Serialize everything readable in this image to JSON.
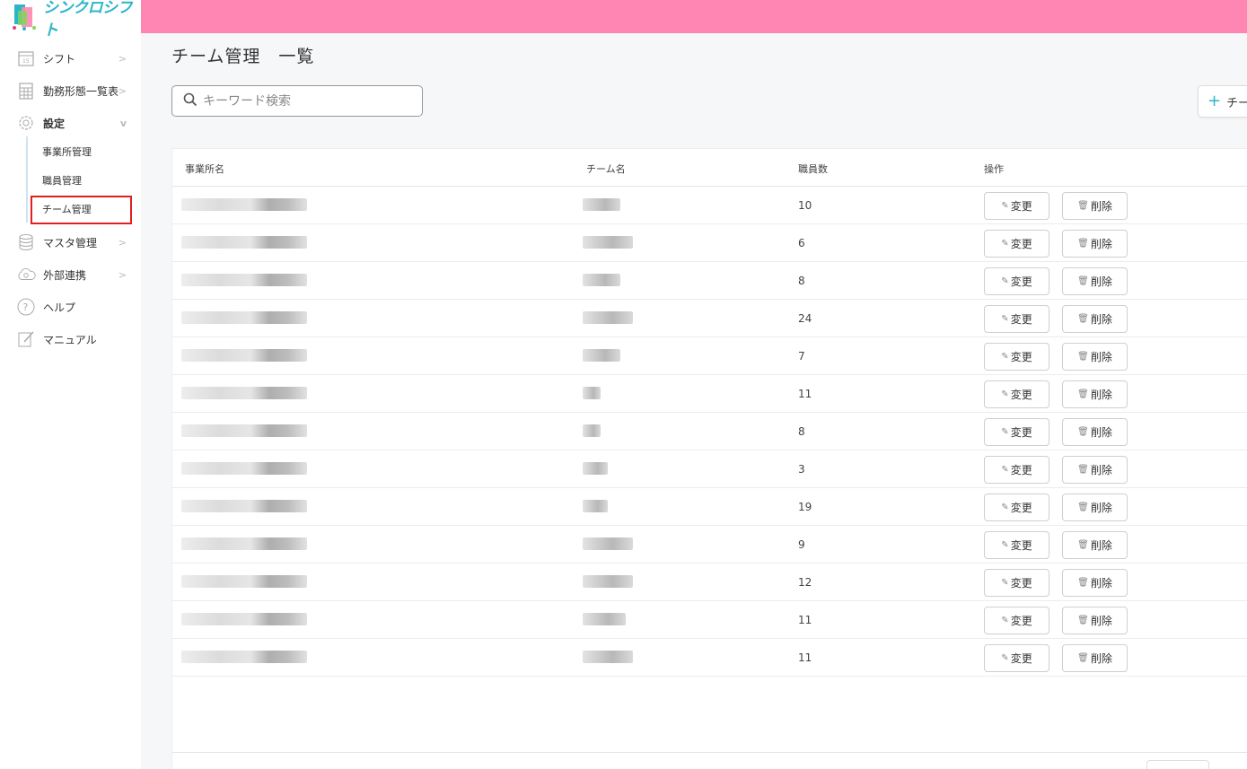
{
  "app": {
    "logo_text": "シンクロシフト",
    "brand_color": "#2bb5c9",
    "topbar_color": "#ff86b3"
  },
  "sidebar": {
    "items": [
      {
        "label": "シフト",
        "icon": "calendar-icon",
        "has_chevron": true
      },
      {
        "label": "勤務形態一覧表",
        "icon": "table-icon",
        "has_chevron": true
      },
      {
        "label": "設定",
        "icon": "gear-icon",
        "has_chevron": true,
        "expanded": true
      },
      {
        "label": "マスタ管理",
        "icon": "database-icon",
        "has_chevron": true
      },
      {
        "label": "外部連携",
        "icon": "cloud-sync-icon",
        "has_chevron": true
      },
      {
        "label": "ヘルプ",
        "icon": "help-icon",
        "has_chevron": false
      },
      {
        "label": "マニュアル",
        "icon": "edit-icon",
        "has_chevron": false
      }
    ],
    "settings_sub": [
      {
        "label": "事業所管理"
      },
      {
        "label": "職員管理"
      },
      {
        "label": "チーム管理",
        "active": true
      }
    ]
  },
  "main": {
    "title": "チーム管理　一覧",
    "search_placeholder": "キーワード検索",
    "add_button_label": "チー",
    "table": {
      "headers": [
        "事業所名",
        "チーム名",
        "職員数",
        "操作"
      ],
      "edit_label": "変更",
      "delete_label": "削除",
      "rows": [
        {
          "count": "10"
        },
        {
          "count": "6"
        },
        {
          "count": "8"
        },
        {
          "count": "24"
        },
        {
          "count": "7"
        },
        {
          "count": "11"
        },
        {
          "count": "8"
        },
        {
          "count": "3"
        },
        {
          "count": "19"
        },
        {
          "count": "9"
        },
        {
          "count": "12"
        },
        {
          "count": "11"
        },
        {
          "count": "11"
        }
      ]
    }
  }
}
